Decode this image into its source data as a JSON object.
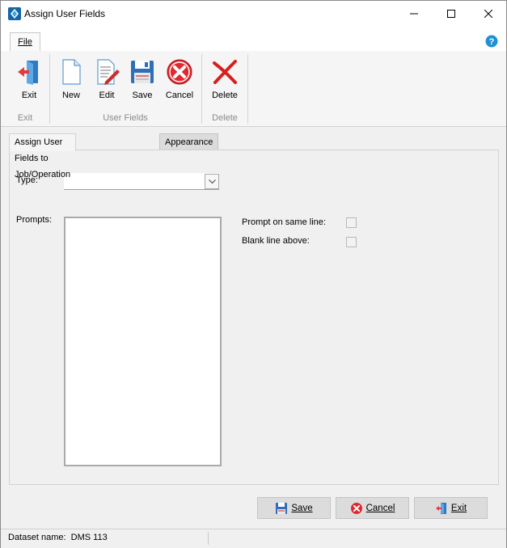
{
  "window": {
    "title": "Assign User Fields"
  },
  "ribbon": {
    "file_tab": "File",
    "groups": {
      "exit": "Exit",
      "user_fields": "User Fields",
      "delete": "Delete"
    },
    "buttons": {
      "exit": "Exit",
      "new": "New",
      "edit": "Edit",
      "save": "Save",
      "cancel": "Cancel",
      "delete": "Delete"
    }
  },
  "tabs": [
    {
      "label": "Assign User Fields to Job/Operation",
      "active": true
    },
    {
      "label": "Appearance",
      "active": false
    }
  ],
  "form": {
    "type_label": "Type:",
    "type_value": "",
    "prompts_label": "Prompts:",
    "prompts_items": [],
    "prompt_same_line_label": "Prompt on same line:",
    "prompt_same_line_checked": false,
    "blank_line_above_label": "Blank line above:",
    "blank_line_above_checked": false
  },
  "footer": {
    "save": "Save",
    "cancel": "Cancel",
    "exit": "Exit"
  },
  "status": {
    "dataset": "Dataset name:  DMS 113"
  },
  "colors": {
    "accent": "#1e90d6",
    "cancel_red": "#e0282e",
    "delete_red": "#d81e1e"
  }
}
